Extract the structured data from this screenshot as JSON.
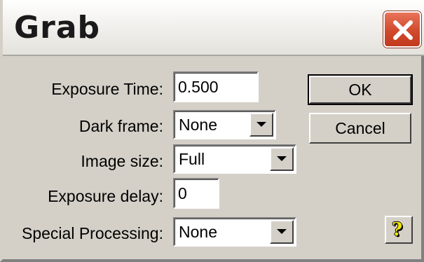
{
  "window": {
    "title": "Grab"
  },
  "titlebar": {
    "close_icon": "close-icon"
  },
  "form": {
    "exposure_time": {
      "label": "Exposure Time:",
      "value": "0.500"
    },
    "dark_frame": {
      "label": "Dark frame:",
      "selected": "None"
    },
    "image_size": {
      "label": "Image size:",
      "selected": "Full"
    },
    "exposure_delay": {
      "label": "Exposure delay:",
      "value": "0"
    },
    "special_processing": {
      "label": "Special Processing:",
      "selected": "None"
    }
  },
  "buttons": {
    "ok_label": "OK",
    "cancel_label": "Cancel",
    "help_label": "?"
  },
  "colors": {
    "dialog_face": "#d4d0c8",
    "close_button": "#d14a2c",
    "help_icon": "#f2e600"
  }
}
